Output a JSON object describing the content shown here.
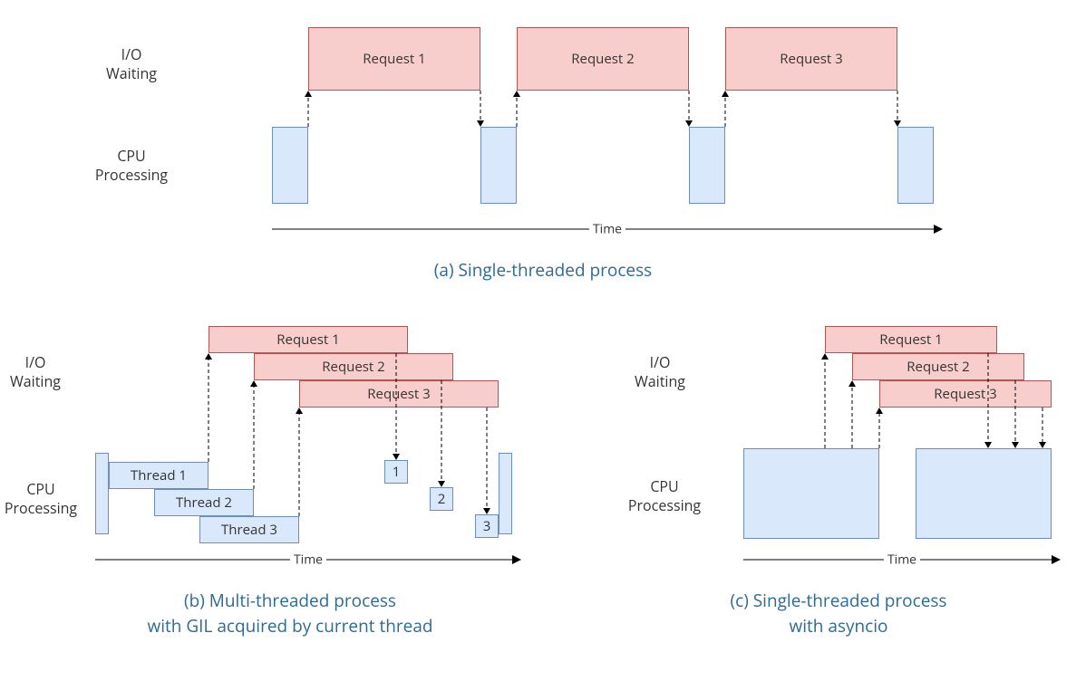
{
  "labels": {
    "io_waiting": "I/O\nWaiting",
    "cpu_processing": "CPU\nProcessing",
    "time": "Time"
  },
  "captions": {
    "a": "(a) Single-threaded process",
    "b": "(b) Multi-threaded process\nwith GIL acquired by current thread",
    "c": "(c) Single-threaded process\nwith asyncio"
  },
  "panel_a": {
    "requests": [
      "Request 1",
      "Request 2",
      "Request 3"
    ]
  },
  "panel_b": {
    "requests": [
      "Request 1",
      "Request 2",
      "Request 3"
    ],
    "threads": [
      "Thread 1",
      "Thread 2",
      "Thread 3"
    ],
    "small": [
      "1",
      "2",
      "3"
    ]
  },
  "panel_c": {
    "requests": [
      "Request 1",
      "Request 2",
      "Request 3"
    ]
  }
}
